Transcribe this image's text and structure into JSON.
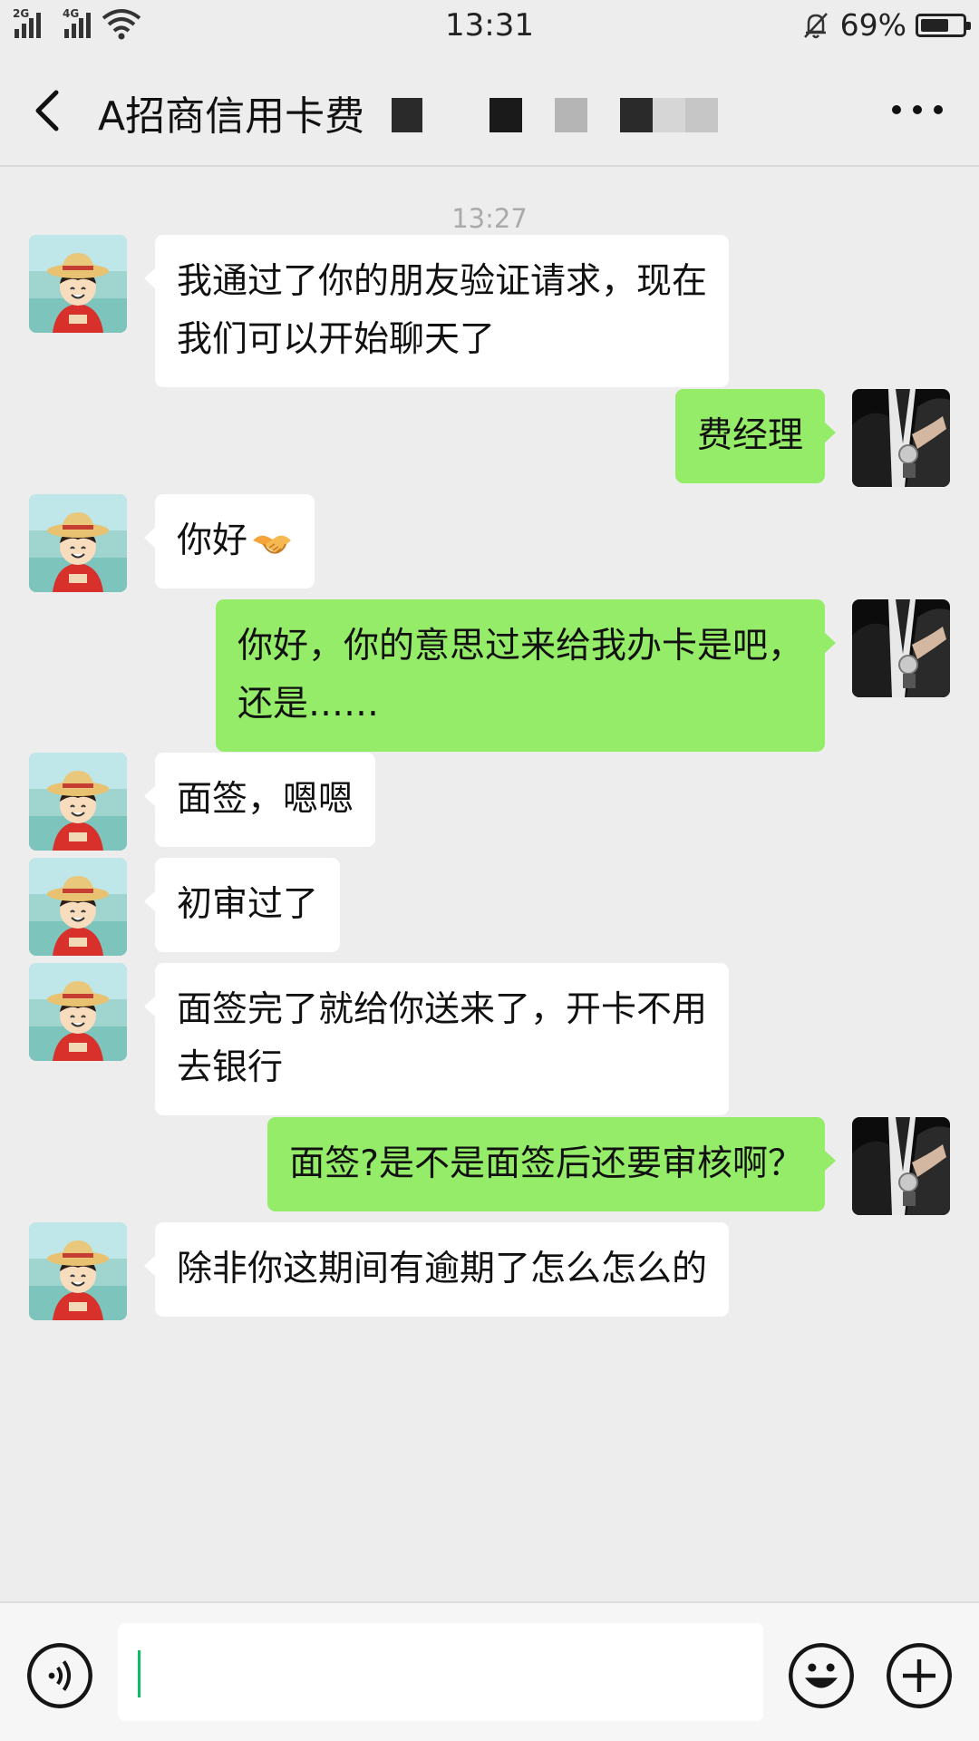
{
  "status_bar": {
    "sim1_label": "2G",
    "sim2_label": "4G",
    "time": "13:31",
    "battery_percent": "69%",
    "battery_level": 0.69
  },
  "header": {
    "title": "A招商信用卡费"
  },
  "chat": {
    "timestamp": "13:27",
    "messages": [
      {
        "side": "in",
        "text": "我通过了你的朋友验证请求，现在\n我们可以开始聊天了"
      },
      {
        "side": "out",
        "text": "费经理"
      },
      {
        "side": "in",
        "text": "你好",
        "emoji": "handshake-emoji"
      },
      {
        "side": "out",
        "text": "你好，你的意思过来给我办卡是吧，\n还是……"
      },
      {
        "side": "in",
        "text": "面签，嗯嗯"
      },
      {
        "side": "in",
        "text": "初审过了"
      },
      {
        "side": "in",
        "text": "面签完了就给你送来了，开卡不用\n去银行"
      },
      {
        "side": "out",
        "text": "面签?是不是面签后还要审核啊？"
      },
      {
        "side": "in",
        "text": "除非你这期间有逾期了怎么怎么的"
      }
    ]
  },
  "input_bar": {
    "value": "",
    "icons": [
      "voice-icon",
      "emoji-icon",
      "plus-icon"
    ]
  },
  "colors": {
    "background": "#ededed",
    "incoming_bubble": "#ffffff",
    "outgoing_bubble": "#95ec69",
    "caret": "#07c160"
  }
}
